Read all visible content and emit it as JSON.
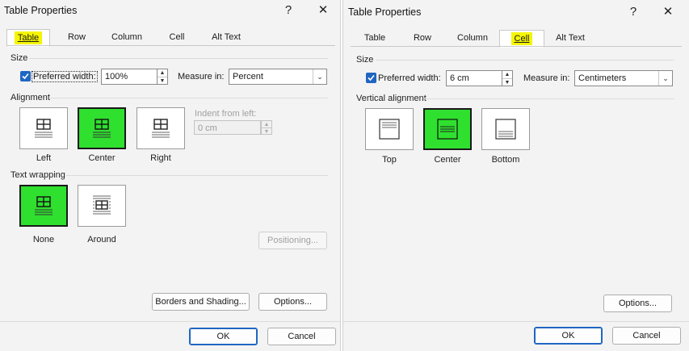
{
  "left": {
    "title": "Table Properties",
    "help": "?",
    "close": "✕",
    "tabs": [
      "Table",
      "Row",
      "Column",
      "Cell",
      "Alt Text"
    ],
    "active_tab": "Table",
    "size": {
      "group": "Size",
      "preferred_width_label": "Preferred width:",
      "preferred_width_checked": true,
      "width_value": "100%",
      "measure_label": "Measure in:",
      "measure_value": "Percent"
    },
    "alignment": {
      "group": "Alignment",
      "options": [
        "Left",
        "Center",
        "Right"
      ],
      "selected": "Center",
      "indent_label": "Indent from left:",
      "indent_value": "0 cm"
    },
    "wrapping": {
      "group": "Text wrapping",
      "options": [
        "None",
        "Around"
      ],
      "selected": "None",
      "positioning": "Positioning..."
    },
    "buttons": {
      "borders": "Borders and Shading...",
      "options": "Options...",
      "ok": "OK",
      "cancel": "Cancel"
    }
  },
  "right": {
    "title": "Table Properties",
    "help": "?",
    "close": "✕",
    "tabs": [
      "Table",
      "Row",
      "Column",
      "Cell",
      "Alt Text"
    ],
    "active_tab": "Cell",
    "size": {
      "group": "Size",
      "preferred_width_label": "Preferred width:",
      "preferred_width_checked": true,
      "width_value": "6 cm",
      "measure_label": "Measure in:",
      "measure_value": "Centimeters"
    },
    "vertical_alignment": {
      "group": "Vertical alignment",
      "options": [
        "Top",
        "Center",
        "Bottom"
      ],
      "selected": "Center"
    },
    "buttons": {
      "options": "Options...",
      "ok": "OK",
      "cancel": "Cancel"
    }
  },
  "colors": {
    "highlight_yellow": "#f5f500",
    "selection_green": "#2fe02f",
    "accent_blue": "#1f66c2"
  },
  "icons": [
    "help-icon",
    "close-icon",
    "checkmark-icon",
    "spin-up-icon",
    "spin-down-icon",
    "dropdown-chevron-icon",
    "table-align-left-icon",
    "table-align-center-icon",
    "table-align-right-icon",
    "wrap-none-icon",
    "wrap-around-icon",
    "cell-align-top-icon",
    "cell-align-center-icon",
    "cell-align-bottom-icon"
  ]
}
